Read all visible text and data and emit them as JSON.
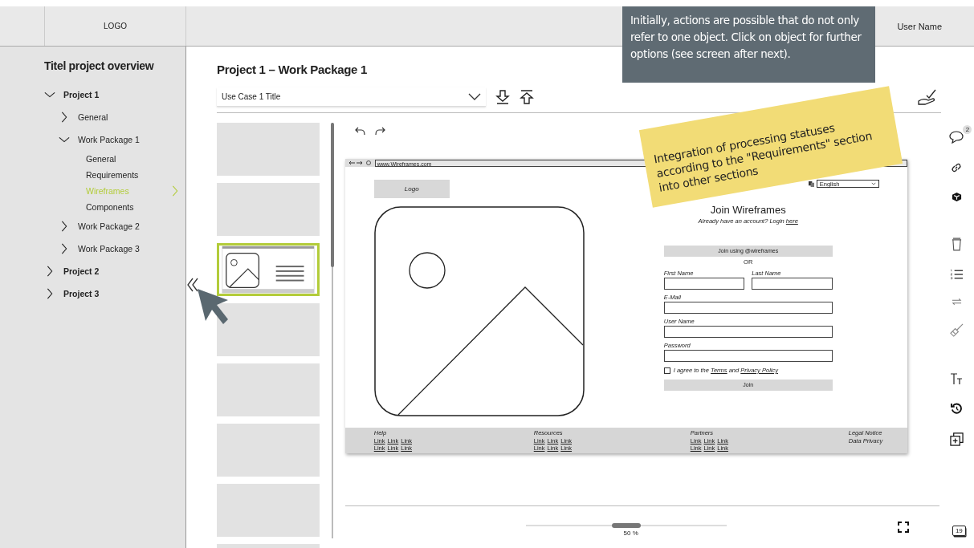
{
  "top_bar": {
    "logo": "LOGO",
    "user_name": "User Name"
  },
  "sidebar": {
    "title": "Titel project overview",
    "tree": [
      {
        "kind": "folder",
        "label": "Project 1",
        "expanded": true,
        "children": [
          {
            "kind": "folder",
            "label": "General",
            "expanded": false
          },
          {
            "kind": "folder",
            "label": "Work Package 1",
            "expanded": true,
            "children": [
              {
                "kind": "page",
                "label": "General",
                "selected": false
              },
              {
                "kind": "page",
                "label": "Requirements",
                "selected": false
              },
              {
                "kind": "page",
                "label": "Wireframes",
                "selected": true
              },
              {
                "kind": "page",
                "label": "Components",
                "selected": false
              }
            ]
          },
          {
            "kind": "folder",
            "label": "Work Package 2",
            "expanded": false
          },
          {
            "kind": "folder",
            "label": "Work Package 3",
            "expanded": false
          }
        ]
      },
      {
        "kind": "folder",
        "label": "Project 2",
        "expanded": false
      },
      {
        "kind": "folder",
        "label": "Project 3",
        "expanded": false
      }
    ]
  },
  "main": {
    "title": "Project 1 – Work Package 1",
    "use_case": "Use Case 1 Title"
  },
  "thumbnails": [
    {
      "kind": "blank",
      "selected": false
    },
    {
      "kind": "blank",
      "selected": false
    },
    {
      "kind": "wireframe",
      "selected": true
    },
    {
      "kind": "blank",
      "selected": false
    },
    {
      "kind": "blank",
      "selected": false
    },
    {
      "kind": "blank",
      "selected": false
    },
    {
      "kind": "blank",
      "selected": false
    },
    {
      "kind": "blank",
      "selected": false
    }
  ],
  "preview": {
    "url": "www.Wireframes.com",
    "logo": "Logo",
    "language": "English",
    "heading": "Join Wireframes",
    "login_prompt": "Already have an account? Login",
    "login_link": "here",
    "social_button": "Join using @wireframes",
    "separator": "OR",
    "fields": [
      {
        "kind": "half",
        "label": "First Name"
      },
      {
        "kind": "half",
        "label": "Last Name"
      },
      {
        "kind": "full",
        "label": "E-Mail"
      },
      {
        "kind": "full",
        "label": "User Name"
      },
      {
        "kind": "full",
        "label": "Password"
      }
    ],
    "agree": {
      "checked": false,
      "text": "I agree to the",
      "terms": "Terms",
      "and": "and",
      "privacy": "Privacy Policy"
    },
    "submit": "Join",
    "footer": [
      {
        "kind": "links",
        "heading": "Help",
        "links": [
          "Link",
          "Link",
          "Link",
          "Link",
          "Link",
          "Link"
        ]
      },
      {
        "kind": "links",
        "heading": "Resources",
        "links": [
          "Link",
          "Link",
          "Link",
          "Link",
          "Link",
          "Link"
        ]
      },
      {
        "kind": "links",
        "heading": "Partners",
        "links": [
          "Link",
          "Link",
          "Link",
          "Link",
          "Link",
          "Link"
        ]
      },
      {
        "kind": "plain",
        "lines": [
          "Legal Notice",
          "Data Privacy"
        ]
      }
    ]
  },
  "right_toolbar": {
    "comment_count": "2"
  },
  "zoom": {
    "level": 0.5,
    "reading": "50 %"
  },
  "calendar_day": "19",
  "tooltip": "Initially, actions are possible that do not only refer to one object. Click on object for further options (see screen after next).",
  "sticky_note": "Integration of processing statuses according to the \"Requirements\" section into other sections"
}
